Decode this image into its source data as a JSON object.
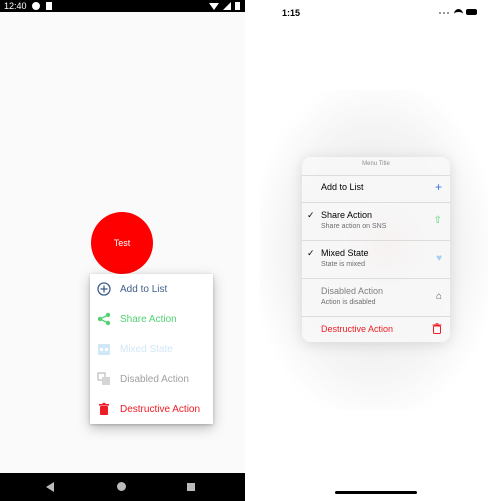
{
  "android": {
    "status": {
      "time": "12:40"
    },
    "test_button": {
      "label": "Test",
      "color": "#ff0000"
    },
    "menu": {
      "items": [
        {
          "label": "Add to List",
          "color": "#3f5f8a",
          "icon": "plus-circle-icon"
        },
        {
          "label": "Share Action",
          "color": "#52d273",
          "icon": "share-icon"
        },
        {
          "label": "Mixed State",
          "color": "#d0e7f7",
          "icon": "calendar-icon"
        },
        {
          "label": "Disabled Action",
          "color": "#a0a0a0",
          "icon": "copy-icon"
        },
        {
          "label": "Destructive Action",
          "color": "#ee1c24",
          "icon": "trash-icon"
        }
      ]
    }
  },
  "ios": {
    "status": {
      "time": "1:15"
    },
    "menu": {
      "title": "Menu Title",
      "items": [
        {
          "label": "Add to List",
          "subtitle": "",
          "checked": false,
          "icon": "plus-icon",
          "icon_glyph": "+",
          "icon_color": "#3a73e0",
          "label_color": "#000000"
        },
        {
          "label": "Share Action",
          "subtitle": "Share action on SNS",
          "checked": true,
          "check": "✓",
          "icon": "share-icon",
          "icon_glyph": "⇧",
          "icon_color": "#52d273",
          "label_color": "#000000"
        },
        {
          "label": "Mixed State",
          "subtitle": "State is mixed",
          "checked": true,
          "check": "✓",
          "icon": "heart-icon",
          "icon_glyph": "♥",
          "icon_color": "#a7cff1",
          "label_color": "#000000"
        },
        {
          "label": "Disabled Action",
          "subtitle": "Action is disabled",
          "checked": false,
          "icon": "tray-icon",
          "icon_glyph": "⌂",
          "icon_color": "#555555",
          "label_color": "#7f7f7f"
        },
        {
          "label": "Destructive Action",
          "subtitle": "",
          "checked": false,
          "icon": "trash-icon",
          "icon_glyph": "🗑",
          "icon_color": "#ee1c24",
          "label_color": "#ee1c24"
        }
      ]
    }
  }
}
